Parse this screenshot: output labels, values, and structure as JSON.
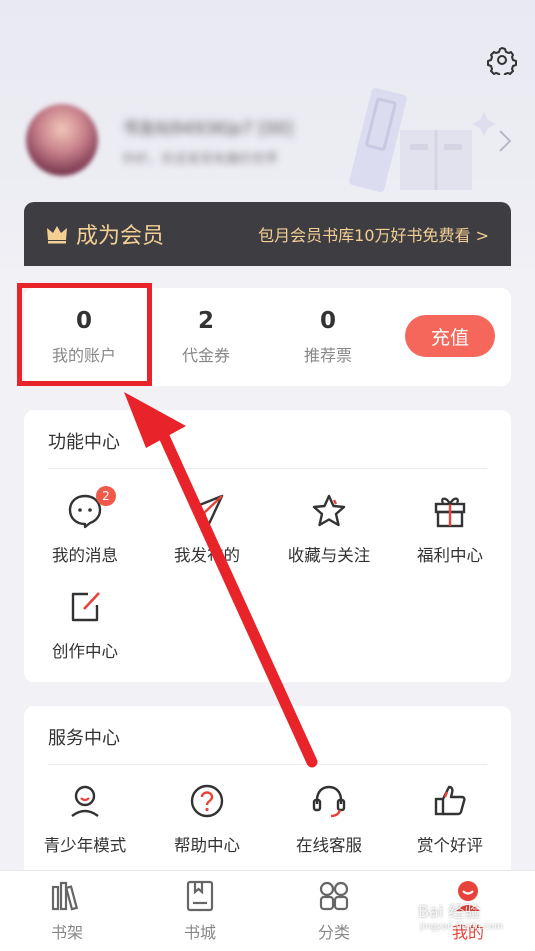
{
  "header": {
    "username": "书友6J9493KJp7 [00]",
    "user_desc": "你好，欢迎发现有趣的世界"
  },
  "vip": {
    "title": "成为会员",
    "promo": "包月会员书库10万好书免费看 >"
  },
  "assets": [
    {
      "value": "0",
      "label": "我的账户"
    },
    {
      "value": "2",
      "label": "代金券"
    },
    {
      "value": "0",
      "label": "推荐票"
    }
  ],
  "recharge_label": "充值",
  "function_center": {
    "title": "功能中心",
    "items": [
      {
        "label": "我的消息",
        "icon": "message-icon",
        "badge": "2"
      },
      {
        "label": "我发布的",
        "icon": "paper-plane-icon"
      },
      {
        "label": "收藏与关注",
        "icon": "star-icon"
      },
      {
        "label": "福利中心",
        "icon": "gift-icon"
      },
      {
        "label": "创作中心",
        "icon": "edit-icon"
      }
    ]
  },
  "service_center": {
    "title": "服务中心",
    "items": [
      {
        "label": "青少年模式",
        "icon": "youth-mode-icon"
      },
      {
        "label": "帮助中心",
        "icon": "help-icon"
      },
      {
        "label": "在线客服",
        "icon": "headset-icon"
      },
      {
        "label": "赏个好评",
        "icon": "thumbs-up-icon"
      }
    ]
  },
  "bottom_nav": [
    {
      "label": "书架",
      "icon": "bookshelf-icon",
      "active": false
    },
    {
      "label": "书城",
      "icon": "book-store-icon",
      "active": false
    },
    {
      "label": "分类",
      "icon": "category-icon",
      "active": false
    },
    {
      "label": "我的",
      "icon": "profile-icon",
      "active": true
    }
  ],
  "watermark": {
    "text": "Bai 经验",
    "sub": "jingyan.baidu.com"
  },
  "colors": {
    "accent": "#f4675a",
    "vip_bar": "#3e3e42",
    "vip_gold": "#f3cf93",
    "annotation_red": "#e8232a"
  }
}
